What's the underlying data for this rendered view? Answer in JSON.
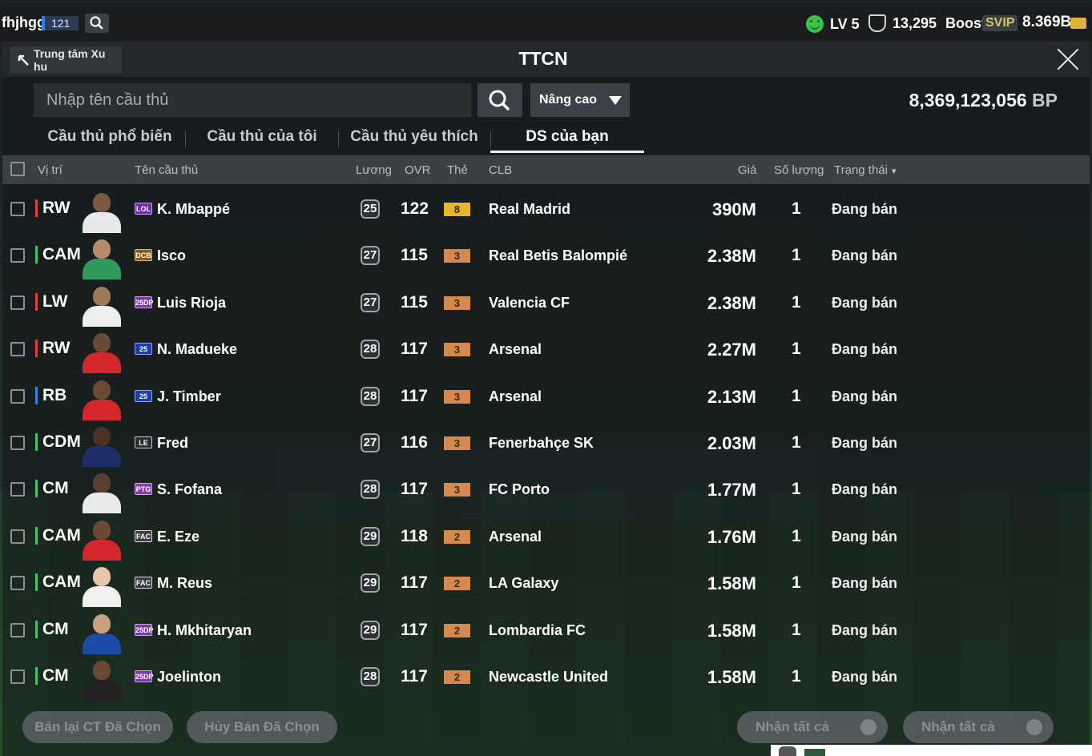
{
  "topbar": {
    "username": "fhjhgg",
    "user_level_badge": "121",
    "level": "LV 5",
    "coins": "13,295",
    "boost_label": "Boost",
    "vip_label": "SVIP",
    "bp_short": "8.369B",
    "colors": {
      "level_icon": "#3cc24a",
      "coin_icon": "#e0b43a"
    }
  },
  "header": {
    "back_label": "Trung tâm Xu hu",
    "title": "TTCN"
  },
  "search": {
    "placeholder": "Nhập tên cầu thủ",
    "advanced_label": "Nâng cao",
    "bp_total": "8,369,123,056",
    "bp_unit": "BP"
  },
  "tabs": [
    {
      "label": "Cầu thủ phổ biến",
      "active": false
    },
    {
      "label": "Cầu thủ của tôi",
      "active": false
    },
    {
      "label": "Cầu thủ yêu thích",
      "active": false
    },
    {
      "label": "DS của bạn",
      "active": true
    }
  ],
  "table": {
    "columns": {
      "position": "Vị trí",
      "name": "Tên cầu thủ",
      "salary": "Lương",
      "ovr": "OVR",
      "card": "Thẻ",
      "club": "CLB",
      "price": "Giá",
      "quantity": "Số lượng",
      "status": "Trạng thái"
    },
    "rows": [
      {
        "position": "RW",
        "season": "LOL",
        "name": "K. Mbappé",
        "salary": "25",
        "ovr": "122",
        "card": "8",
        "club": "Real Madrid",
        "price": "390M",
        "quantity": "1",
        "status": "Đang bán"
      },
      {
        "position": "CAM",
        "season": "DCB",
        "name": "Isco",
        "salary": "27",
        "ovr": "115",
        "card": "3",
        "club": "Real Betis Balompié",
        "price": "2.38M",
        "quantity": "1",
        "status": "Đang bán"
      },
      {
        "position": "LW",
        "season": "25DP",
        "name": "Luis Rioja",
        "salary": "27",
        "ovr": "115",
        "card": "3",
        "club": "Valencia CF",
        "price": "2.38M",
        "quantity": "1",
        "status": "Đang bán"
      },
      {
        "position": "RW",
        "season": "25",
        "name": "N. Madueke",
        "salary": "28",
        "ovr": "117",
        "card": "3",
        "club": "Arsenal",
        "price": "2.27M",
        "quantity": "1",
        "status": "Đang bán"
      },
      {
        "position": "RB",
        "season": "25",
        "name": "J. Timber",
        "salary": "28",
        "ovr": "117",
        "card": "3",
        "club": "Arsenal",
        "price": "2.13M",
        "quantity": "1",
        "status": "Đang bán"
      },
      {
        "position": "CDM",
        "season": "LE",
        "name": "Fred",
        "salary": "27",
        "ovr": "116",
        "card": "3",
        "club": "Fenerbahçe SK",
        "price": "2.03M",
        "quantity": "1",
        "status": "Đang bán"
      },
      {
        "position": "CM",
        "season": "PTG",
        "name": "S. Fofana",
        "salary": "28",
        "ovr": "117",
        "card": "3",
        "club": "FC Porto",
        "price": "1.77M",
        "quantity": "1",
        "status": "Đang bán"
      },
      {
        "position": "CAM",
        "season": "FAC",
        "name": "E. Eze",
        "salary": "29",
        "ovr": "118",
        "card": "2",
        "club": "Arsenal",
        "price": "1.76M",
        "quantity": "1",
        "status": "Đang bán"
      },
      {
        "position": "CAM",
        "season": "FAC",
        "name": "M. Reus",
        "salary": "29",
        "ovr": "117",
        "card": "2",
        "club": "LA Galaxy",
        "price": "1.58M",
        "quantity": "1",
        "status": "Đang bán"
      },
      {
        "position": "CM",
        "season": "25DP",
        "name": "H. Mkhitaryan",
        "salary": "29",
        "ovr": "117",
        "card": "2",
        "club": "Lombardia FC",
        "price": "1.58M",
        "quantity": "1",
        "status": "Đang bán"
      },
      {
        "position": "CM",
        "season": "25DP",
        "name": "Joelinton",
        "salary": "28",
        "ovr": "117",
        "card": "2",
        "club": "Newcastle United",
        "price": "1.58M",
        "quantity": "1",
        "status": "Đang bán"
      }
    ]
  },
  "footer": {
    "resell_label": "Bán lại CT Đã Chọn",
    "cancel_label": "Hủy Bán Đã Chọn",
    "claim_all_label": "Nhận tất cả",
    "claim_all_bp_label": "Nhận tất cả"
  },
  "style": {
    "position_colors": {
      "forward": "#e0413c",
      "midfield": "#3ec46a",
      "defense": "#3d7de8"
    },
    "card_colors": {
      "gold": "#e8b52e",
      "bronze": "#d5894e"
    }
  }
}
